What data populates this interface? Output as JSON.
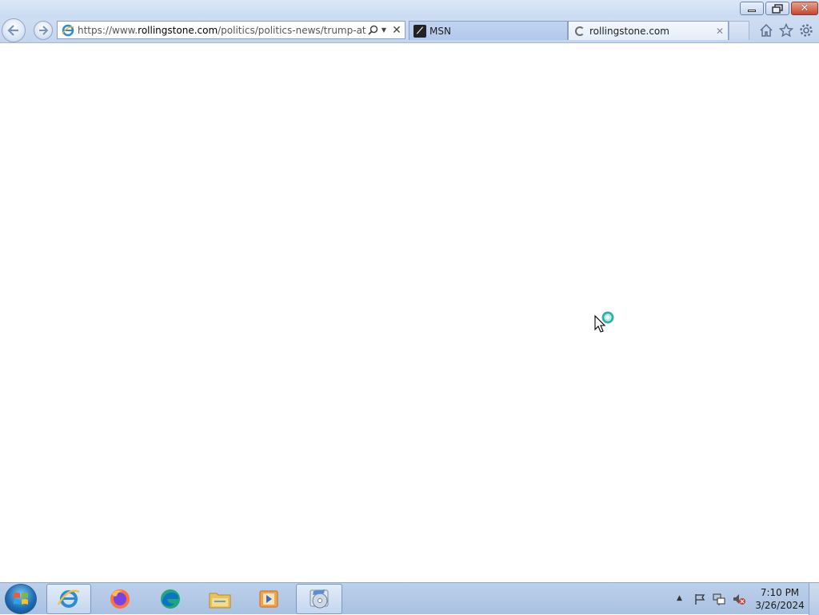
{
  "browser": {
    "address": {
      "prefix": "https://www.",
      "domain": "rollingstone.com",
      "path": "/politics/politics-news/trump-attacks"
    },
    "tabs": [
      {
        "label": "MSN",
        "active": false
      },
      {
        "label": "rollingstone.com",
        "active": true,
        "loading": true
      }
    ],
    "toolbar_icons": [
      "home-icon",
      "favorites-star-icon",
      "tools-gear-icon"
    ]
  },
  "taskbar": {
    "apps": [
      "internet-explorer",
      "firefox",
      "edge",
      "file-explorer",
      "windows-media-player",
      "dvd-maker"
    ],
    "clock": {
      "time": "7:10 PM",
      "date": "3/26/2024"
    }
  },
  "colors": {
    "titlebar": "#c9dbf2",
    "taskbar": "#a9c1e1",
    "close_button": "#c4462d"
  }
}
